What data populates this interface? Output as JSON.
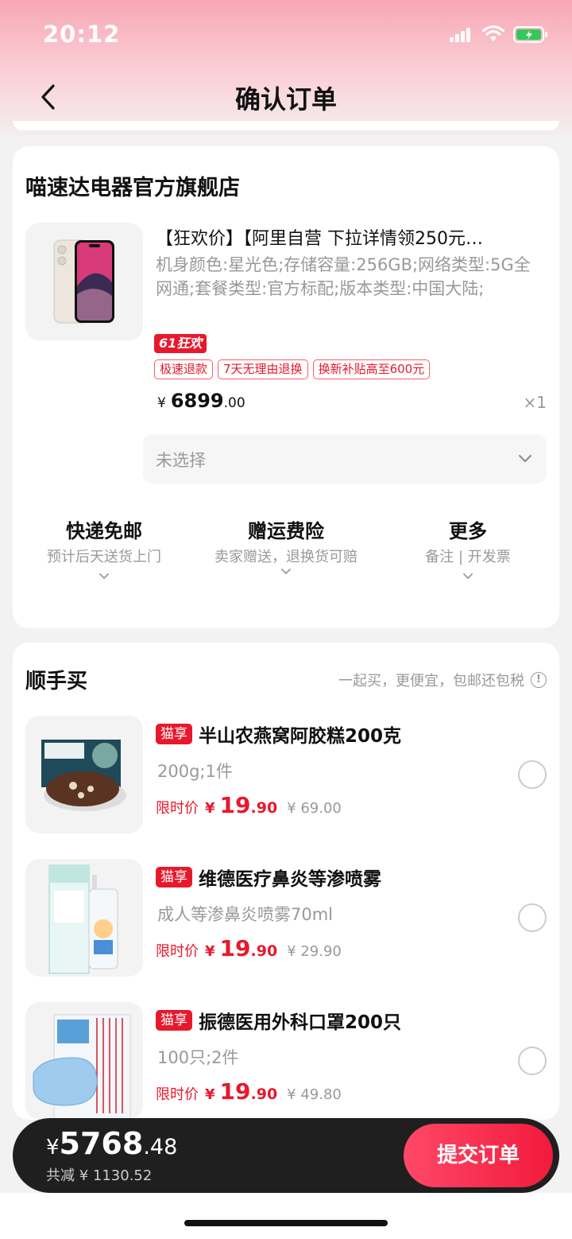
{
  "status_bar": {
    "time": "20:12"
  },
  "nav": {
    "title": "确认订单"
  },
  "store": {
    "name": "喵速达电器官方旗舰店",
    "product": {
      "title": "【狂欢价】【阿里自营 下拉详情领250元…",
      "spec": "机身颜色:星光色;存储容量:256GB;网络类型:5G全网通;套餐类型:官方标配;版本类型:中国大陆;",
      "promo_badge": "61狂欢",
      "tags": [
        "极速退款",
        "7天无理由退换",
        "换新补贴高至600元"
      ],
      "price_currency": "¥",
      "price_int": "6899",
      "price_dec": ".00",
      "quantity": "×1"
    },
    "selector": {
      "value": "未选择"
    },
    "services": [
      {
        "title": "快递免邮",
        "subtitle": "预计后天送货上门"
      },
      {
        "title": "赠运费险",
        "subtitle": "卖家赠送，退换货可赔"
      },
      {
        "title": "更多",
        "subtitle": "备注 | 开发票"
      }
    ]
  },
  "addons": {
    "title": "顺手买",
    "hint": "一起买，更便宜，包邮还包税",
    "items": [
      {
        "badge": "猫享",
        "name": "半山农燕窝阿胶糕200克",
        "spec": "200g;1件",
        "limit_label": "限时价",
        "currency": "¥",
        "price_int": "19",
        "price_dec": ".90",
        "original": "¥ 69.00"
      },
      {
        "badge": "猫享",
        "name": "维德医疗鼻炎等渗喷雾",
        "spec": "成人等渗鼻炎喷雾70ml",
        "limit_label": "限时价",
        "currency": "¥",
        "price_int": "19",
        "price_dec": ".90",
        "original": "¥ 29.90"
      },
      {
        "badge": "猫享",
        "name": "振德医用外科口罩200只",
        "spec": "100只;2件",
        "limit_label": "限时价",
        "currency": "¥",
        "price_int": "19",
        "price_dec": ".90",
        "original": "¥ 49.80"
      }
    ]
  },
  "checkout": {
    "currency": "¥",
    "total_int": "5768",
    "total_dec": ".48",
    "discount": "共减 ¥ 1130.52",
    "submit_label": "提交订单"
  },
  "colors": {
    "accent": "#e8182c",
    "bar": "#1f1f1f"
  }
}
